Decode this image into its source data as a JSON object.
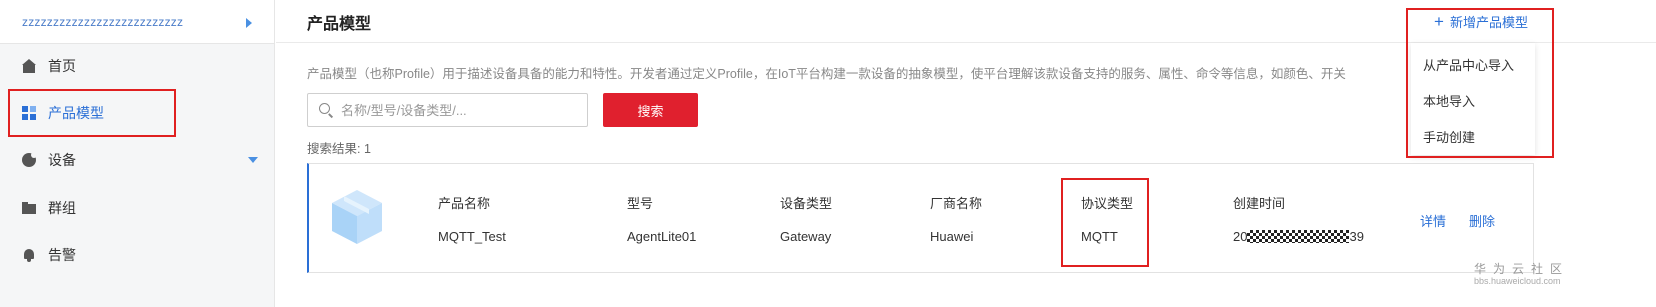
{
  "sidebar": {
    "project_name": "zzzzzzzzzzzzzzzzzzzzzzzzzz",
    "items": [
      {
        "label": "首页",
        "icon": "home-icon"
      },
      {
        "label": "产品模型",
        "icon": "product-model-icon",
        "active": true
      },
      {
        "label": "设备",
        "icon": "device-icon",
        "expandable": true
      },
      {
        "label": "群组",
        "icon": "folder-icon"
      },
      {
        "label": "告警",
        "icon": "bell-icon"
      }
    ]
  },
  "header": {
    "title": "产品模型",
    "add_button": "新增产品模型"
  },
  "dropdown": {
    "items": [
      "从产品中心导入",
      "本地导入",
      "手动创建"
    ]
  },
  "main": {
    "description": "产品模型（也称Profile）用于描述设备具备的能力和特性。开发者通过定义Profile，在IoT平台构建一款设备的抽象模型，使平台理解该款设备支持的服务、属性、命令等信息，如颜色、开关",
    "search_placeholder": "名称/型号/设备类型/...",
    "search_button": "搜索",
    "result_count": "搜索结果: 1"
  },
  "product_card": {
    "columns": [
      {
        "header": "产品名称",
        "value": "MQTT_Test"
      },
      {
        "header": "型号",
        "value": "AgentLite01"
      },
      {
        "header": "设备类型",
        "value": "Gateway"
      },
      {
        "header": "厂商名称",
        "value": "Huawei"
      },
      {
        "header": "协议类型",
        "value": "MQTT"
      },
      {
        "header": "创建时间",
        "value_prefix": "20",
        "value_suffix": "39"
      }
    ],
    "actions": [
      "详情",
      "删除"
    ]
  },
  "watermark": {
    "text": "华为云社区",
    "sub": "bbs.huaweicloud.com"
  },
  "colors": {
    "accent": "#2a6fd6",
    "primary_button": "#e0202e",
    "highlight_box": "#e02020"
  }
}
